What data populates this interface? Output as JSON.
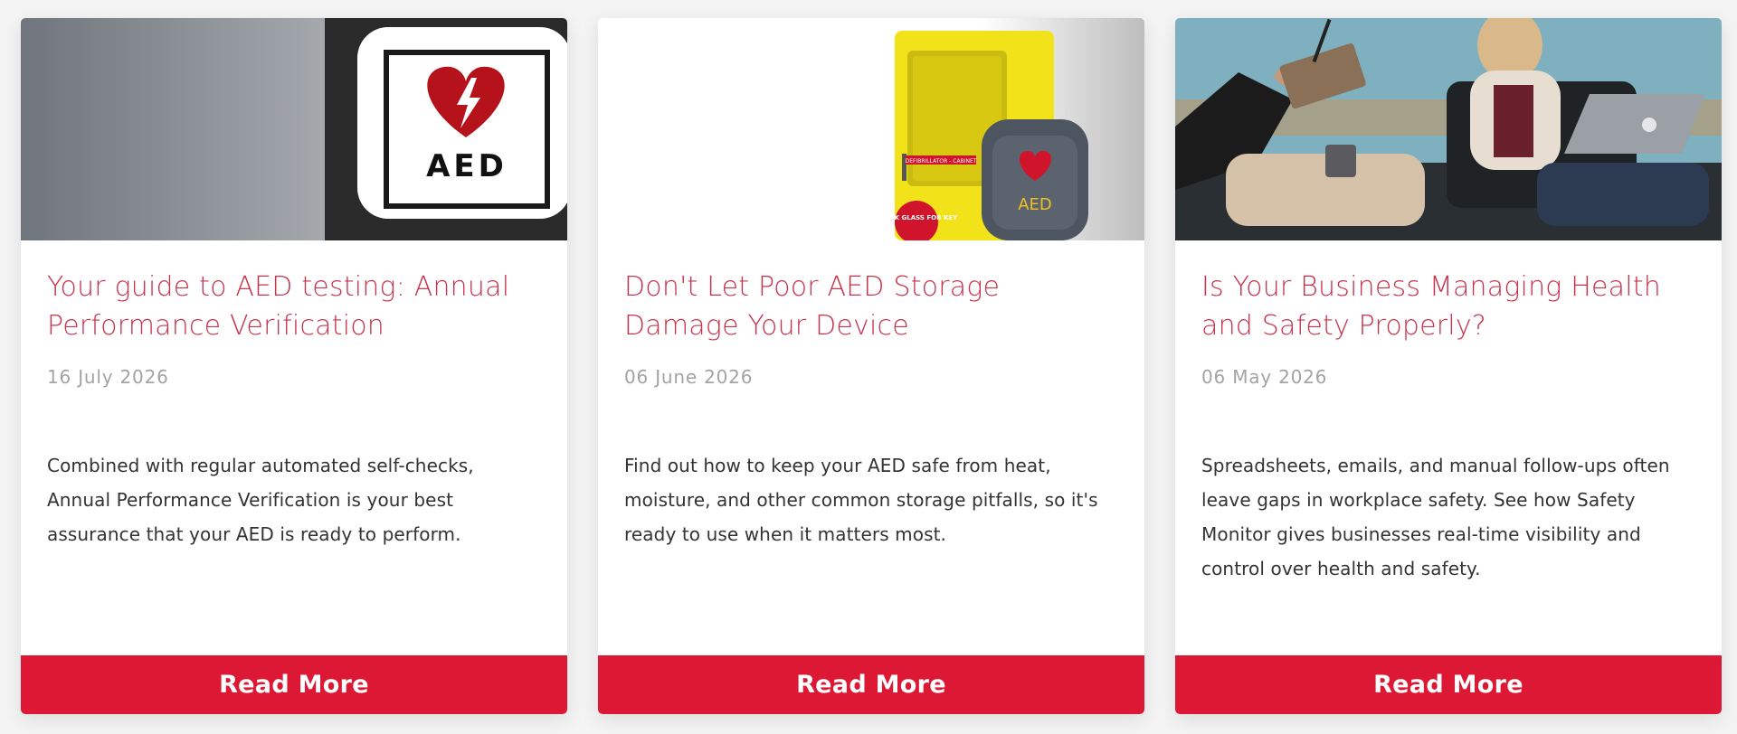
{
  "posts": [
    {
      "image": {
        "description": "aed-sign",
        "sign_text": "AED",
        "colors": {
          "heart": "#b5121b",
          "frame": "#ffffff",
          "wall": "#8e9398"
        }
      },
      "title": "Your guide to AED testing: Annual Performance Verification",
      "date": "16 July 2026",
      "excerpt": "Combined with regular automated self-checks, Annual Performance Verification is your best assurance that your AED is ready to perform.",
      "button_label": "Read More"
    },
    {
      "image": {
        "description": "aed-storage-cabinet",
        "cabinet_text": "DEFIBRILLATOR - CABINET",
        "bag_text": "AED",
        "sticker_text": "BREAK GLASS FOR KEY",
        "colors": {
          "cabinet": "#f2e21a",
          "bag": "#4d5560",
          "sticker": "#d0142b"
        }
      },
      "title": "Don't Let Poor AED Storage Damage Your Device",
      "date": "06 June 2026",
      "excerpt": "Find out how to keep your AED safe from heat, moisture, and other common storage pitfalls, so it's ready to use when it matters most.",
      "button_label": "Read More"
    },
    {
      "image": {
        "description": "business-meeting-photo",
        "colors": {
          "wall": "#7fb0bf",
          "sofa": "#2a2f33",
          "shirt": "#6a1f2c"
        }
      },
      "title": "Is Your Business Managing Health and Safety Properly?",
      "date": "06 May 2026",
      "excerpt": "Spreadsheets, emails, and manual follow-ups often leave gaps in workplace safety. See how Safety Monitor gives businesses real-time visibility and control over health and safety.",
      "button_label": "Read More"
    }
  ],
  "theme": {
    "accent": "#dc1834",
    "title_color": "#c8334c",
    "date_color": "#a3a3a3",
    "text_color": "#333333"
  }
}
